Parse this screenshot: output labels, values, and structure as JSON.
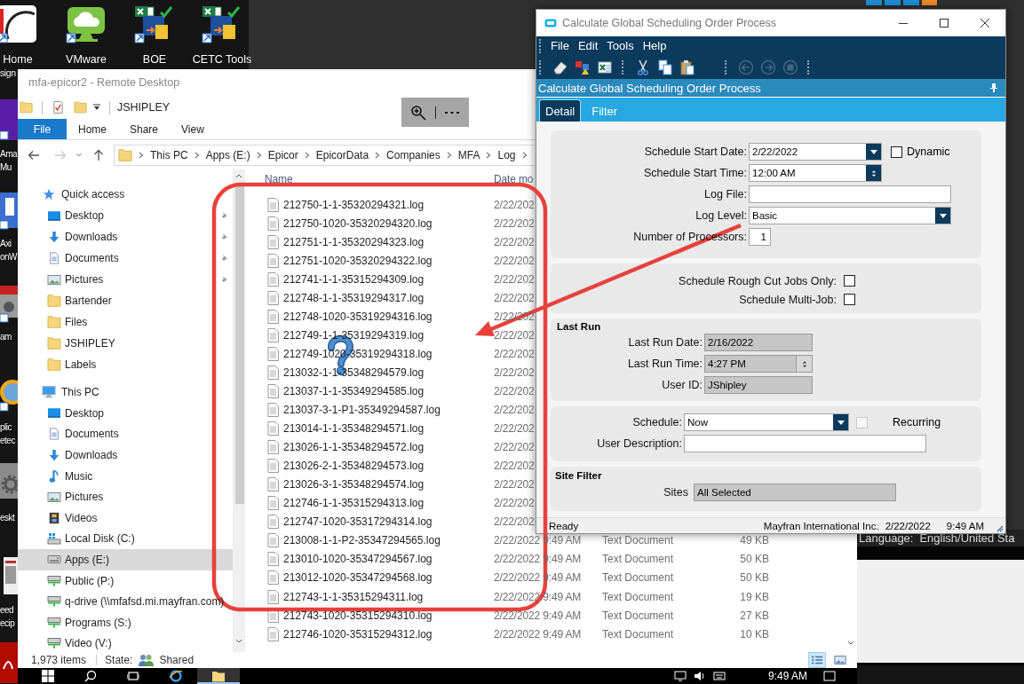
{
  "desktop": {
    "top_icons": [
      {
        "kind": "hd",
        "label": "Home",
        "label_2": "sign"
      },
      {
        "kind": "cloud",
        "label": "VMware"
      },
      {
        "kind": "sheet",
        "label": "BOE"
      },
      {
        "kind": "sheet",
        "label": "CETC Tools"
      }
    ],
    "edge_icons": [
      {
        "kind": "music",
        "lines": [
          "Ama",
          "Mu"
        ]
      },
      {
        "kind": "app",
        "lines": [
          "Axi",
          "onW"
        ]
      },
      {
        "kind": "photo",
        "lines": [
          "am"
        ]
      },
      {
        "kind": "disc",
        "lines": [
          "plic",
          "etec"
        ]
      },
      {
        "kind": "gear",
        "lines": [
          "eskt"
        ]
      },
      {
        "kind": "doc",
        "lines": [
          "eed",
          "ecip"
        ]
      },
      {
        "kind": "pdf"
      }
    ],
    "background_window": {
      "language_label": "Language:",
      "language_value": "English/United Sta"
    }
  },
  "remote_desktop": {
    "title": "mfa-epicor2 - Remote Desktop",
    "explorer": {
      "location": "JSHIPLEY",
      "ribbon_tabs": [
        {
          "label": "File",
          "kind": "file"
        },
        {
          "label": "Home",
          "kind": "tab"
        },
        {
          "label": "Share",
          "kind": "tab"
        },
        {
          "label": "View",
          "kind": "tab"
        }
      ],
      "breadcrumb": [
        "This PC",
        "Apps (E:)",
        "Epicor",
        "EpicorData",
        "Companies",
        "MFA",
        "Log"
      ],
      "nav_pane": [
        {
          "label": "Quick access",
          "kind": "star",
          "selected": false,
          "children": [
            {
              "label": "Desktop",
              "kind": "desktop",
              "pinned": true,
              "selected": false
            },
            {
              "label": "Downloads",
              "kind": "downloads",
              "pinned": true,
              "selected": false
            },
            {
              "label": "Documents",
              "kind": "documents",
              "pinned": true,
              "selected": false
            },
            {
              "label": "Pictures",
              "kind": "pictures",
              "pinned": true,
              "selected": false
            },
            {
              "label": "Bartender",
              "kind": "folder",
              "pinned": false,
              "selected": false
            },
            {
              "label": "Files",
              "kind": "folder",
              "pinned": false,
              "selected": false
            },
            {
              "label": "JSHIPLEY",
              "kind": "folder",
              "pinned": false,
              "selected": false
            },
            {
              "label": "Labels",
              "kind": "folder",
              "pinned": false,
              "selected": false
            }
          ]
        },
        {
          "label": "This PC",
          "kind": "pc",
          "selected": false,
          "children": [
            {
              "label": "Desktop",
              "kind": "desktop",
              "pinned": false,
              "selected": false
            },
            {
              "label": "Documents",
              "kind": "documents",
              "pinned": false,
              "selected": false
            },
            {
              "label": "Downloads",
              "kind": "downloads",
              "pinned": false,
              "selected": false
            },
            {
              "label": "Music",
              "kind": "music",
              "pinned": false,
              "selected": false
            },
            {
              "label": "Pictures",
              "kind": "pictures",
              "pinned": false,
              "selected": false
            },
            {
              "label": "Videos",
              "kind": "videos",
              "pinned": false,
              "selected": false
            },
            {
              "label": "Local Disk (C:)",
              "kind": "system_drive",
              "pinned": false,
              "selected": false
            },
            {
              "label": "Apps (E:)",
              "kind": "drive",
              "pinned": false,
              "selected": true
            },
            {
              "label": "Public (P:)",
              "kind": "network_drive",
              "pinned": false,
              "selected": false
            },
            {
              "label": "q-drive (\\\\mfafsd.mi.mayfran.com)",
              "kind": "network_drive",
              "pinned": false,
              "selected": false
            },
            {
              "label": "Programs (S:)",
              "kind": "network_drive",
              "pinned": false,
              "selected": false
            },
            {
              "label": "Video (V:)",
              "kind": "network_drive",
              "pinned": false,
              "selected": false
            }
          ]
        }
      ],
      "columns": [
        "Name",
        "Date mo"
      ],
      "files": [
        {
          "name": "212750-1-1-35320294321.log",
          "modified": "2/22/202"
        },
        {
          "name": "212750-1020-35320294320.log",
          "modified": "2/22/202"
        },
        {
          "name": "212751-1-1-35320294323.log",
          "modified": "2/22/202"
        },
        {
          "name": "212751-1020-35320294322.log",
          "modified": "2/22/202"
        },
        {
          "name": "212741-1-1-35315294309.log",
          "modified": "2/22/202"
        },
        {
          "name": "212748-1-1-35319294317.log",
          "modified": "2/22/202"
        },
        {
          "name": "212748-1020-35319294316.log",
          "modified": "2/22/202"
        },
        {
          "name": "212749-1-1-35319294319.log",
          "modified": "2/22/202"
        },
        {
          "name": "212749-1020-35319294318.log",
          "modified": "2/22/202"
        },
        {
          "name": "213032-1-1-35348294579.log",
          "modified": "2/22/202"
        },
        {
          "name": "213037-1-1-35349294585.log",
          "modified": "2/22/202"
        },
        {
          "name": "213037-3-1-P1-35349294587.log",
          "modified": "2/22/202"
        },
        {
          "name": "213014-1-1-35348294571.log",
          "modified": "2/22/202"
        },
        {
          "name": "213026-1-1-35348294572.log",
          "modified": "2/22/202"
        },
        {
          "name": "213026-2-1-35348294573.log",
          "modified": "2/22/202"
        },
        {
          "name": "213026-3-1-35348294574.log",
          "modified": "2/22/202"
        },
        {
          "name": "212746-1-1-35315294313.log",
          "modified": "2/22/202"
        },
        {
          "name": "212747-1020-35317294314.log",
          "modified": "2/22/202"
        },
        {
          "name": "213008-1-1-P2-35347294565.log",
          "modified": "2/22/2022 9:49 AM",
          "type": "Text Document",
          "size": "49 KB"
        },
        {
          "name": "213010-1020-35347294567.log",
          "modified": "2/22/2022 9:49 AM",
          "type": "Text Document",
          "size": "50 KB"
        },
        {
          "name": "213012-1020-35347294568.log",
          "modified": "2/22/2022 9:49 AM",
          "type": "Text Document",
          "size": "50 KB"
        },
        {
          "name": "212743-1-1-35315294311.log",
          "modified": "2/22/2022 9:49 AM",
          "type": "Text Document",
          "size": "19 KB"
        },
        {
          "name": "212743-1020-35315294310.log",
          "modified": "2/22/2022 9:49 AM",
          "type": "Text Document",
          "size": "27 KB"
        },
        {
          "name": "212746-1020-35315294312.log",
          "modified": "2/22/2022 9:49 AM",
          "type": "Text Document",
          "size": "10 KB"
        }
      ],
      "status": {
        "count": "1,973 items",
        "state_label": "State:",
        "state_value": "Shared"
      },
      "view_buttons": [
        {
          "kind": "details",
          "selected": true
        },
        {
          "kind": "thumbnails",
          "selected": false
        }
      ]
    },
    "taskbar": {
      "apps": [
        {
          "kind": "start",
          "active": false
        },
        {
          "kind": "search",
          "active": false
        },
        {
          "kind": "task_view",
          "active": false
        },
        {
          "kind": "browser",
          "active": false
        },
        {
          "kind": "folder",
          "active": true
        }
      ],
      "clock": "9:49 AM"
    }
  },
  "scheduler": {
    "title": "Calculate Global Scheduling Order Process",
    "menu": [
      "File",
      "Edit",
      "Tools",
      "Help"
    ],
    "toolbar_groups": [
      {
        "tools": [
          {
            "kind": "eraser",
            "disabled": false
          },
          {
            "kind": "shapes",
            "disabled": false
          },
          {
            "kind": "spreadsheet",
            "disabled": false
          }
        ]
      },
      {
        "tools": [
          {
            "kind": "cut",
            "disabled": false
          },
          {
            "kind": "copy",
            "disabled": false
          },
          {
            "kind": "paste",
            "disabled": false
          }
        ]
      },
      {
        "tools": [
          {
            "kind": "back",
            "disabled": true
          },
          {
            "kind": "forward",
            "disabled": true
          },
          {
            "kind": "stop",
            "disabled": true
          }
        ]
      }
    ],
    "heading": "Calculate Global Scheduling Order Process",
    "tabs": [
      {
        "label": "Detail",
        "selected": true
      },
      {
        "label": "Filter",
        "selected": false
      }
    ],
    "sections": [
      {
        "fields": [
          {
            "kind": "date",
            "label": "Schedule Start Date:",
            "value": "2/22/2022",
            "read_only": false,
            "option": {
              "label": "Dynamic",
              "checked": false,
              "disabled": false
            }
          },
          {
            "kind": "time",
            "label": "Schedule Start Time:",
            "value": "12:00 AM",
            "read_only": false
          },
          {
            "kind": "text",
            "label": "Log File:",
            "read_only": false
          },
          {
            "kind": "dropdown",
            "label": "Log Level:",
            "value": "Basic",
            "read_only": false
          },
          {
            "kind": "number",
            "label": "Number of Processors:",
            "value": "1",
            "read_only": false
          }
        ]
      },
      {
        "fields": [
          {
            "kind": "checkbox",
            "label": "Schedule Rough Cut Jobs Only:",
            "checked": false
          },
          {
            "kind": "checkbox",
            "label": "Schedule Multi-Job:",
            "checked": false
          }
        ]
      },
      {
        "title": "Last Run",
        "fields": [
          {
            "kind": "text",
            "label": "Last Run Date:",
            "value": "2/16/2022",
            "read_only": true
          },
          {
            "kind": "time",
            "label": "Last Run Time:",
            "value": "4:27 PM",
            "read_only": true
          },
          {
            "kind": "text",
            "label": "User ID:",
            "value": "JShipley",
            "read_only": true
          }
        ]
      },
      {
        "fields": [
          {
            "kind": "dropdown",
            "label": "Schedule:",
            "value": "Now",
            "read_only": false,
            "option": {
              "label": "Recurring",
              "checked": false,
              "disabled": true
            }
          },
          {
            "kind": "text",
            "label": "User Description:",
            "read_only": false
          }
        ]
      },
      {
        "title": "Site Filter",
        "fields": [
          {
            "kind": "text",
            "label": "Sites",
            "value": "All Selected",
            "read_only": true
          }
        ]
      }
    ],
    "status_bar": {
      "status": "Ready",
      "company": "Mayfran International Inc.",
      "date": "2/22/2022",
      "time": "9:49 AM"
    }
  }
}
